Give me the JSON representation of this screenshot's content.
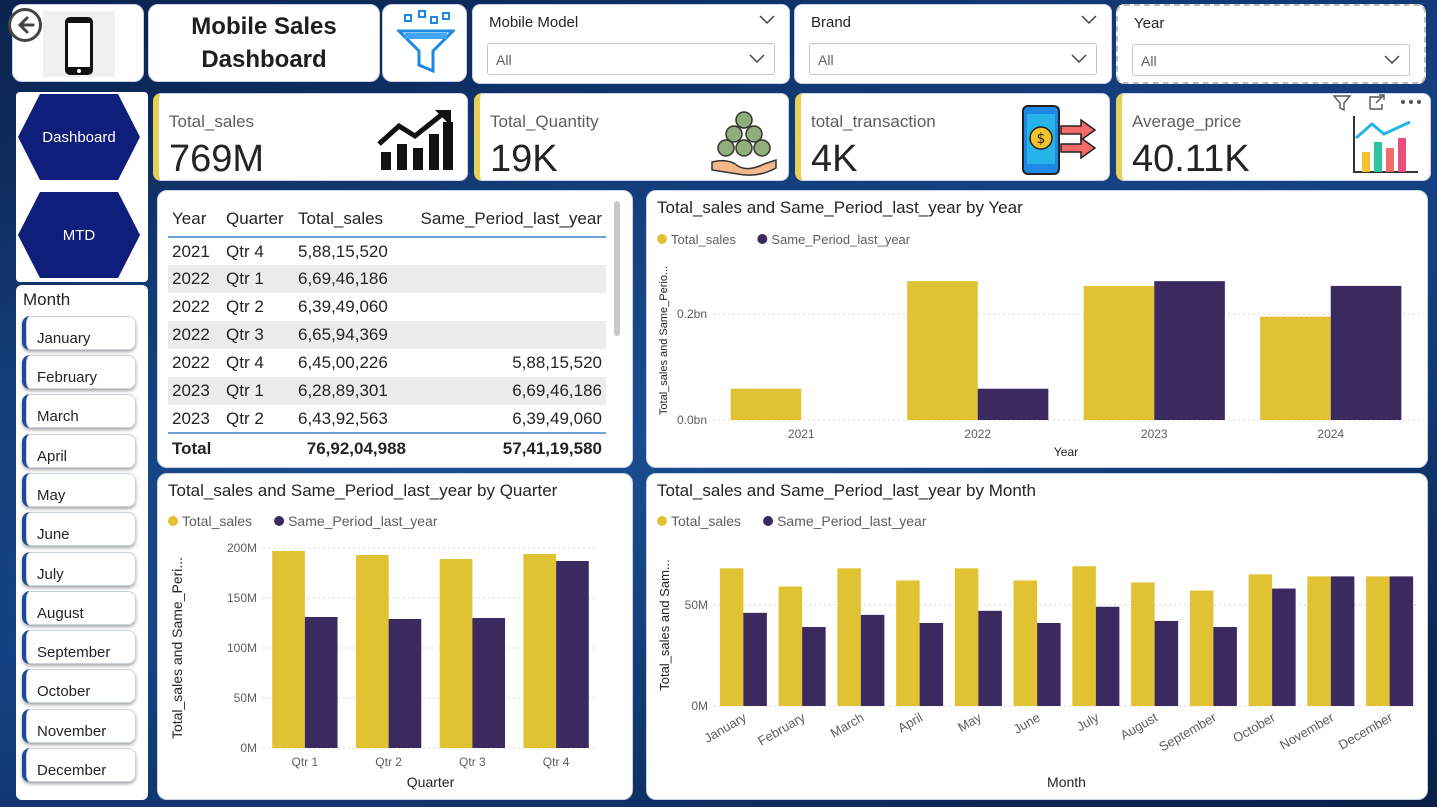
{
  "header": {
    "title": "Mobile Sales Dashboard",
    "slicers": [
      {
        "label": "Mobile Model",
        "value": "All"
      },
      {
        "label": "Brand",
        "value": "All"
      },
      {
        "label": "Year",
        "value": "All"
      }
    ]
  },
  "nav": {
    "buttons": [
      "Dashboard",
      "MTD"
    ]
  },
  "months": {
    "title": "Month",
    "items": [
      "January",
      "February",
      "March",
      "April",
      "May",
      "June",
      "July",
      "August",
      "September",
      "October",
      "November",
      "December"
    ]
  },
  "kpis": [
    {
      "label": "Total_sales",
      "value": "769M",
      "icon": "chart-up-icon"
    },
    {
      "label": "Total_Quantity",
      "value": "19K",
      "icon": "money-bags-icon"
    },
    {
      "label": "total_transaction",
      "value": "4K",
      "icon": "phone-payment-icon"
    },
    {
      "label": "Average_price",
      "value": "40.11K",
      "icon": "bar-chart-icon"
    }
  ],
  "table": {
    "headers": [
      "Year",
      "Quarter",
      "Total_sales",
      "Same_Period_last_year"
    ],
    "rows": [
      [
        "2021",
        "Qtr 4",
        "5,88,15,520",
        ""
      ],
      [
        "2022",
        "Qtr 1",
        "6,69,46,186",
        ""
      ],
      [
        "2022",
        "Qtr 2",
        "6,39,49,060",
        ""
      ],
      [
        "2022",
        "Qtr 3",
        "6,65,94,369",
        ""
      ],
      [
        "2022",
        "Qtr 4",
        "6,45,00,226",
        "5,88,15,520"
      ],
      [
        "2023",
        "Qtr 1",
        "6,28,89,301",
        "6,69,46,186"
      ],
      [
        "2023",
        "Qtr 2",
        "6,43,92,563",
        "6,39,49,060"
      ]
    ],
    "total": [
      "Total",
      "76,92,04,988",
      "57,41,19,580"
    ]
  },
  "colors": {
    "total_sales": "#e0c232",
    "same_period": "#3b2a60",
    "accent": "#0f1e7a"
  },
  "chart_data": [
    {
      "type": "bar",
      "title": "Total_sales and Same_Period_last_year by Year",
      "xlabel": "Year",
      "ylabel": "Total_sales and Same_Perio...",
      "categories": [
        "2021",
        "2022",
        "2023",
        "2024"
      ],
      "series": [
        {
          "name": "Total_sales",
          "values": [
            0.059,
            0.262,
            0.253,
            0.195
          ]
        },
        {
          "name": "Same_Period_last_year",
          "values": [
            0,
            0.059,
            0.262,
            0.253
          ]
        }
      ],
      "unit": "bn",
      "ylim": [
        0,
        0.3
      ],
      "yticks": [
        {
          "v": 0,
          "label": "0.0bn"
        },
        {
          "v": 0.2,
          "label": "0.2bn"
        }
      ],
      "legend": "top-left"
    },
    {
      "type": "bar",
      "title": "Total_sales and Same_Period_last_year by Quarter",
      "xlabel": "Quarter",
      "ylabel": "Total_sales and Same_Peri...",
      "categories": [
        "Qtr 1",
        "Qtr 2",
        "Qtr 3",
        "Qtr 4"
      ],
      "series": [
        {
          "name": "Total_sales",
          "values": [
            197,
            193,
            189,
            194
          ]
        },
        {
          "name": "Same_Period_last_year",
          "values": [
            131,
            129,
            130,
            187
          ]
        }
      ],
      "unit": "M",
      "ylim": [
        0,
        200
      ],
      "yticks": [
        {
          "v": 0,
          "label": "0M"
        },
        {
          "v": 50,
          "label": "50M"
        },
        {
          "v": 100,
          "label": "100M"
        },
        {
          "v": 150,
          "label": "150M"
        },
        {
          "v": 200,
          "label": "200M"
        }
      ],
      "legend": "top-left"
    },
    {
      "type": "bar",
      "title": "Total_sales and Same_Period_last_year by Month",
      "xlabel": "Month",
      "ylabel": "Total_sales and Sam...",
      "categories": [
        "January",
        "February",
        "March",
        "April",
        "May",
        "June",
        "July",
        "August",
        "September",
        "October",
        "November",
        "December"
      ],
      "series": [
        {
          "name": "Total_sales",
          "values": [
            68,
            59,
            68,
            62,
            68,
            62,
            69,
            61,
            57,
            65,
            64,
            64
          ]
        },
        {
          "name": "Same_Period_last_year",
          "values": [
            46,
            39,
            45,
            41,
            47,
            41,
            49,
            42,
            39,
            58,
            64,
            64
          ]
        }
      ],
      "unit": "M",
      "ylim": [
        0,
        80
      ],
      "yticks": [
        {
          "v": 0,
          "label": "0M"
        },
        {
          "v": 50,
          "label": "50M"
        }
      ],
      "legend": "top-left"
    }
  ]
}
